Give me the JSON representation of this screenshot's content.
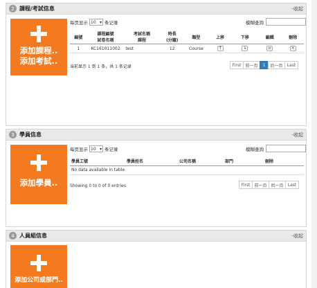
{
  "section1": {
    "num": "2",
    "title": "課程/考試信息",
    "collapse": "-收起",
    "add_line1": "添加課程..",
    "add_line2": "添加考試..",
    "per_page_prefix": "每页显示",
    "per_page_value": "10",
    "per_page_suffix": "条记录",
    "search_label": "模糊查詢",
    "columns": [
      "編號",
      "課程編號\n試卷名稱",
      "考試名稱\n課程",
      "時長\n(分鐘)",
      "類型",
      "上移",
      "下移",
      "編輯",
      "刪除"
    ],
    "row": {
      "no": "1",
      "code": "KC161011002",
      "name": "test",
      "duration": "12",
      "type": "Course"
    },
    "info": "当前显示 1 到 1 条，共 1 条记录",
    "pager": [
      "First",
      "前一页",
      "1",
      "后一页",
      "Last"
    ]
  },
  "section2": {
    "num": "3",
    "title": "學員信息",
    "collapse": "-收起",
    "add_line1": "添加學員..",
    "per_page_prefix": "每页显示",
    "per_page_value": "10",
    "per_page_suffix": "条记录",
    "search_label": "模糊查詢",
    "columns": [
      "學員工號",
      "學員姓名",
      "公司名稱",
      "部門",
      "刪除"
    ],
    "empty": "No data available in table",
    "info": "Showing 0 to 0 of 0 entries",
    "pager": [
      "First",
      "前一页",
      "后一页",
      "Last"
    ]
  },
  "section3": {
    "num": "4",
    "title": "人員組信息",
    "collapse": "-收起",
    "add_line1": "添加公司或部門.."
  }
}
